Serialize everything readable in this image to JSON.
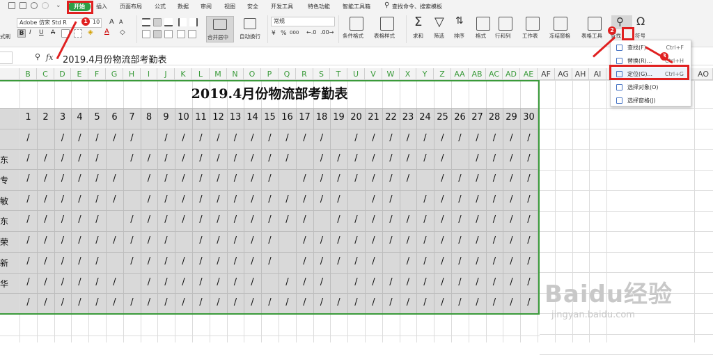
{
  "ribbon": {
    "tabs": [
      "开始",
      "插入",
      "页面布局",
      "公式",
      "数据",
      "审阅",
      "视图",
      "安全",
      "开发工具",
      "特色功能",
      "智能工具箱"
    ],
    "search_placeholder": "查找命令、搜索模板",
    "font_name": "Adobe 仿宋 Std R",
    "font_size": "10",
    "number_format": "常规",
    "left_label": "式刷",
    "merge_label": "合并居中",
    "wrap_label": "自动换行",
    "percent_glyph": "%",
    "comma_glyph": "000",
    "group_labels": [
      "条件格式",
      "表格样式",
      "求和",
      "筛选",
      "排序",
      "格式",
      "行和列",
      "工作表",
      "冻结窗格",
      "表格工具",
      "查找",
      "符号"
    ]
  },
  "formula_bar": {
    "fx": "fx",
    "content": "2019.4月份物流部考勤表"
  },
  "columns": [
    "B",
    "C",
    "D",
    "E",
    "F",
    "G",
    "H",
    "I",
    "J",
    "K",
    "L",
    "M",
    "N",
    "O",
    "P",
    "Q",
    "R",
    "S",
    "T",
    "U",
    "V",
    "W",
    "X",
    "Y",
    "Z",
    "AA",
    "AB",
    "AC",
    "AD",
    "AE",
    "AF",
    "AG",
    "AH",
    "AI",
    "AO"
  ],
  "sheet": {
    "title": "2019.4月份物流部考勤表",
    "days": [
      "1",
      "2",
      "3",
      "4",
      "5",
      "6",
      "7",
      "8",
      "9",
      "10",
      "11",
      "12",
      "13",
      "14",
      "15",
      "16",
      "17",
      "18",
      "19",
      "20",
      "21",
      "22",
      "23",
      "24",
      "25",
      "26",
      "27",
      "28",
      "29",
      "30"
    ],
    "row_names": [
      "",
      "东",
      "专",
      "敏",
      "东",
      "荣",
      "新",
      "华",
      ""
    ],
    "mark": "/",
    "rows": [
      "/./////.//////////./////////",
      "/////.//////////.////////./////",
      "//////.////////.///////.//////",
      "//////.////////////.//./////////",
      "/////.///////////./////////",
      "/////////./////./////////",
      "/////./////////./////.//////",
      "//////.///////.///./////////",
      "////////////////////////////"
    ]
  },
  "dropdown": {
    "items": [
      {
        "label": "查找(F)...",
        "shortcut": "Ctrl+F"
      },
      {
        "label": "替换(R)...",
        "shortcut": "Ctrl+H"
      },
      {
        "label": "定位(G)...",
        "shortcut": "Ctrl+G"
      },
      {
        "label": "选择对象(O)",
        "shortcut": ""
      },
      {
        "label": "选择窗格(J)",
        "shortcut": ""
      }
    ]
  },
  "annotations": {
    "badge1": "1",
    "badge2": "2",
    "badge3": "3"
  },
  "watermark": {
    "brand": "Baidu经验",
    "url": "jingyan.baidu.com"
  },
  "colors": {
    "accent": "#2e9e46",
    "highlight": "#e02020",
    "column_header_text": "#3a9a3a"
  }
}
